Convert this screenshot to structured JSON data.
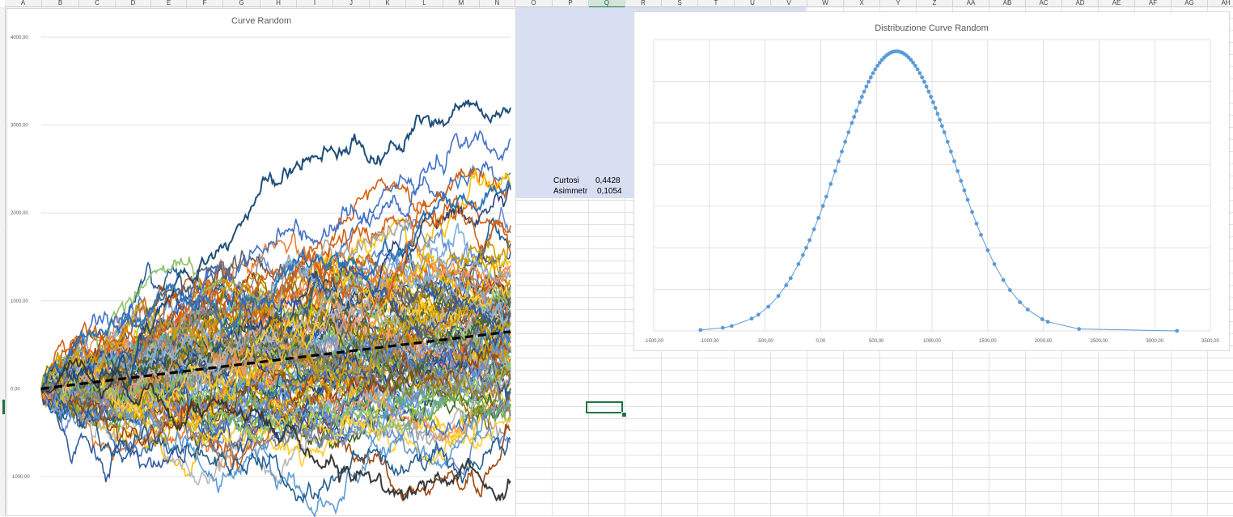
{
  "sheet": {
    "columns": [
      "A",
      "B",
      "C",
      "D",
      "E",
      "F",
      "G",
      "H",
      "I",
      "J",
      "K",
      "L",
      "M",
      "N",
      "O",
      "P",
      "Q",
      "R",
      "S",
      "T",
      "U",
      "V",
      "W",
      "X",
      "Y",
      "Z",
      "AA",
      "AB",
      "AC",
      "AD",
      "AE",
      "AF",
      "AG",
      "AH"
    ],
    "selected_column": "Q",
    "cells": {
      "curtosi_label": "Curtosi",
      "curtosi_value": "0,4428",
      "asimmetria_label": "Asimmetr",
      "asimmetria_value": "0,1054"
    }
  },
  "colors": {
    "grid": "#e1e1e1",
    "selection": "#217346",
    "highlight_fill": "#d9dff2",
    "scatter_marker": "#5b9bd5",
    "mean_line": "#000000"
  },
  "chart_data": [
    {
      "type": "line",
      "title": "Curve Random",
      "xlabel": "",
      "ylabel": "",
      "ylim": [
        -1000,
        4000
      ],
      "y_ticks": [
        "4000,00",
        "3000,00",
        "2000,00",
        "1000,00",
        "0,00",
        "-1000,00"
      ],
      "y_tick_values": [
        4000,
        3000,
        2000,
        1000,
        0,
        -1000
      ],
      "steps": 400,
      "num_series": 110,
      "series_palette": [
        "#4472c4",
        "#ed7d31",
        "#a5a5a5",
        "#ffc000",
        "#5b9bd5",
        "#70ad47",
        "#264478",
        "#9e480e",
        "#636363",
        "#997300",
        "#255e91",
        "#43682b",
        "#698ed0",
        "#f1975a",
        "#b7b7b7",
        "#ffcd33",
        "#7cafdd",
        "#8cc168",
        "#335aa1",
        "#d26012",
        "#848484",
        "#cc9a00"
      ],
      "highlighted_series": [
        {
          "name": "",
          "start": 0,
          "end": 3200,
          "color": "#1f4e79"
        },
        {
          "name": "",
          "start": 0,
          "end": 2300,
          "color": "#2e75b6"
        },
        {
          "name": "",
          "start": 0,
          "end": -1050,
          "color": "#3a3a3a"
        }
      ],
      "mean_series": {
        "name": "",
        "start": 0,
        "end": 650,
        "style": "dashed",
        "color": "#000000"
      }
    },
    {
      "type": "scatter",
      "title": "Distribuzione Curve Random",
      "xlabel": "",
      "ylabel": "",
      "xlim": [
        -1500,
        3500
      ],
      "x_ticks": [
        "-1500,00",
        "-1000,00",
        "-500,00",
        "0,00",
        "500,00",
        "1000,00",
        "1500,00",
        "2000,00",
        "2500,00",
        "3000,00",
        "3500,00"
      ],
      "x_tick_values": [
        -1500,
        -1000,
        -500,
        0,
        500,
        1000,
        1500,
        2000,
        2500,
        3000,
        3500
      ],
      "gridlines": true,
      "marker": "circle",
      "connected": true,
      "distribution": {
        "mean": 680,
        "std": 520,
        "peak_relative": 0.96
      },
      "points_x": [
        -1080,
        -880,
        -800,
        -620,
        -560,
        -470,
        -380,
        -310,
        -270,
        -200,
        -160,
        -130,
        -100,
        -60,
        -20,
        20,
        50,
        90,
        130,
        160,
        190,
        220,
        250,
        280,
        300,
        320,
        350,
        370,
        390,
        410,
        430,
        450,
        470,
        490,
        510,
        530,
        550,
        570,
        590,
        610,
        630,
        650,
        670,
        690,
        710,
        730,
        750,
        770,
        790,
        810,
        830,
        850,
        870,
        890,
        910,
        930,
        950,
        970,
        990,
        1010,
        1030,
        1050,
        1070,
        1090,
        1110,
        1140,
        1170,
        1200,
        1230,
        1260,
        1290,
        1320,
        1360,
        1400,
        1440,
        1500,
        1560,
        1640,
        1700,
        1790,
        1860,
        1990,
        2040,
        2320,
        3200
      ]
    }
  ]
}
